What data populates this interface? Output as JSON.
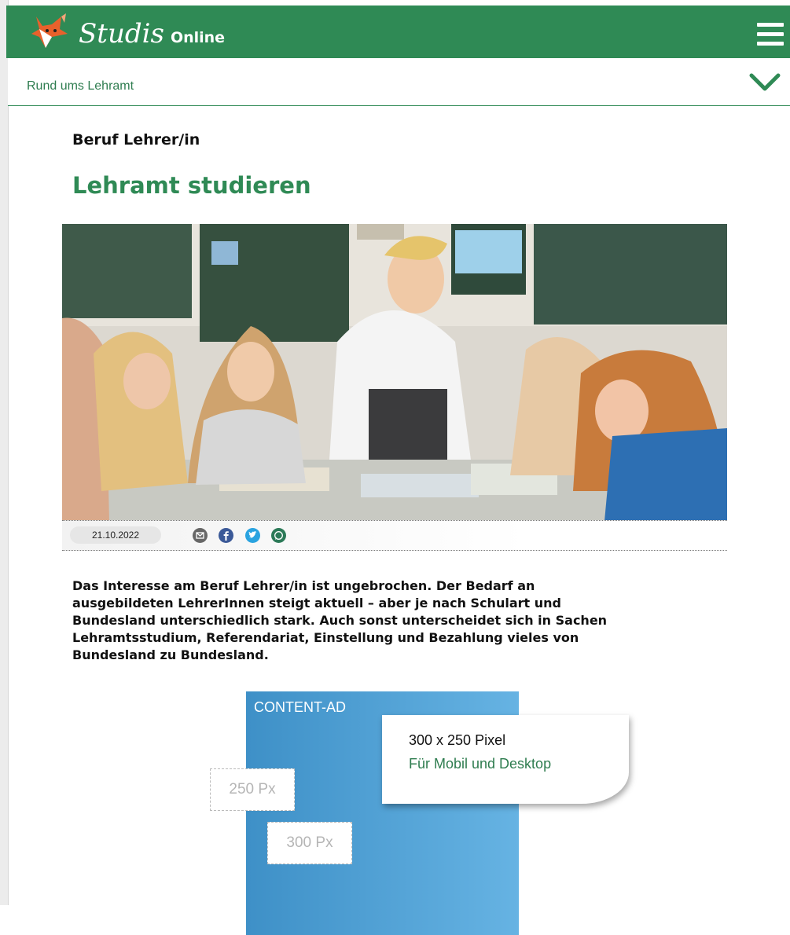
{
  "header": {
    "logo_text": "Studis",
    "logo_sub": "Online",
    "menu_icon": "hamburger-menu-icon"
  },
  "subnav": {
    "label": "Rund ums Lehramt",
    "toggle_icon": "chevron-down-icon"
  },
  "article": {
    "kicker": "Beruf Lehrer/in",
    "title": "Lehramt studieren",
    "date": "21.10.2022",
    "share_icons": [
      "email-icon",
      "facebook-icon",
      "twitter-icon",
      "whatsapp-icon"
    ],
    "intro": "Das Interesse am Beruf Lehrer/in ist ungebrochen. Der Bedarf an ausgebildeten LehrerInnen steigt aktuell – aber je nach Schulart und Bundesland unterschiedlich stark. Auch sonst unterscheidet sich in Sachen Lehramtsstudium, Referendariat, Einstellung und Bezahlung vieles von Bundesland zu Bundesland."
  },
  "ad": {
    "label": "CONTENT-AD",
    "size": "300 x 250 Pixel",
    "platform": "Für Mobil und Desktop",
    "height_label": "250 Px",
    "width_label": "300 Px"
  },
  "colors": {
    "brand_green": "#2f8a55",
    "ad_blue": "#4a9fd6"
  }
}
